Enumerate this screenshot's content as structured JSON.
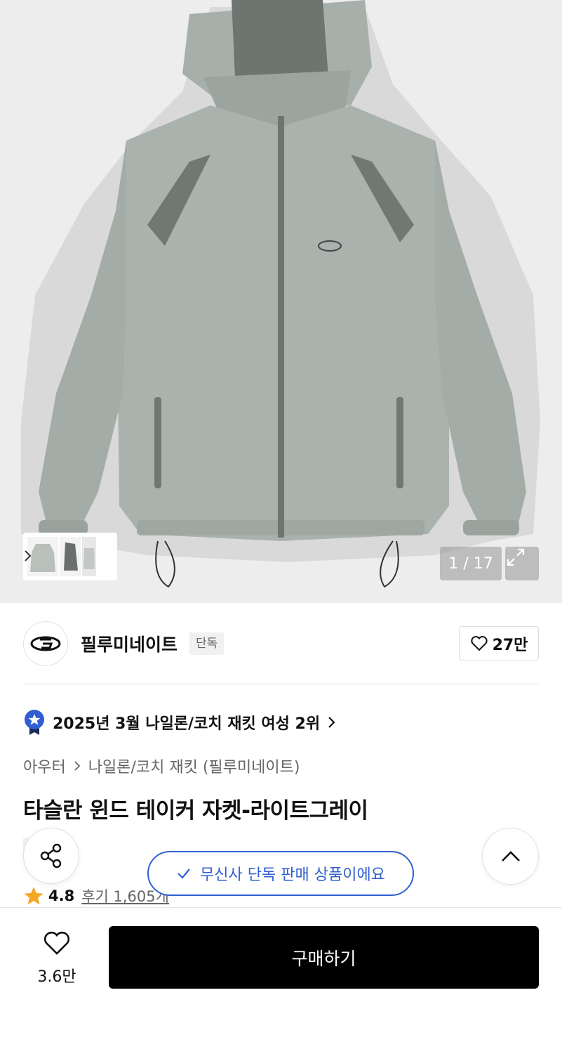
{
  "gallery": {
    "counter": "1 / 17",
    "thumb_icons": [
      "jacket-front-thumb",
      "jacket-side-thumb",
      "jacket-back-thumb"
    ]
  },
  "brand": {
    "name": "필루미네이트",
    "tag": "단독",
    "like_count": "27만"
  },
  "ranking": {
    "text": "2025년 3월 나일론/코치 재킷 여성 2위"
  },
  "breadcrumb": {
    "root": "아우터",
    "category": "나일론/코치 재킷 (필루미네이트)"
  },
  "product": {
    "title": "타슬란 윈드 테이커 자켓-라이트그레이",
    "tag": "단독",
    "rating": "4.8",
    "reviews": "후기 1,605개"
  },
  "toast": {
    "text": "무신사 단독 판매 상품이에요"
  },
  "bottom_bar": {
    "like_count": "3.6만",
    "buy_label": "구매하기"
  },
  "colors": {
    "accent_blue": "#2f5fd0",
    "star": "#f5a623",
    "buy_bg": "#000000",
    "jacket": "#a9b2ad",
    "jacket_panel": "#6f7872"
  }
}
